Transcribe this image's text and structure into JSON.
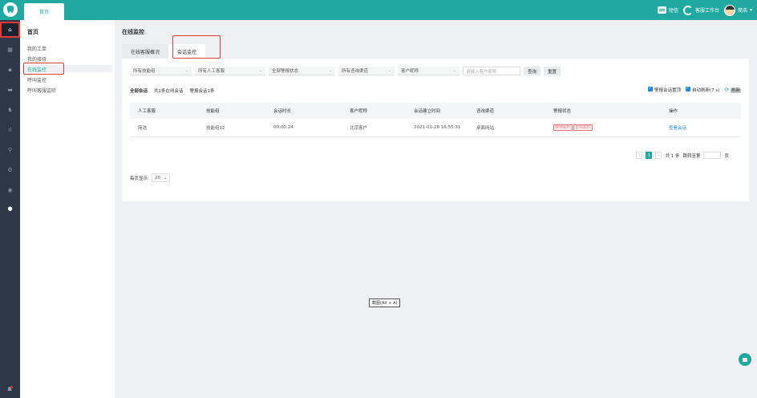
{
  "topbar": {
    "home_tab": "首页",
    "sms_label": "短信",
    "workspace_label": "客服工作台",
    "user_name": "简浩"
  },
  "rail": {
    "items": [
      "home-icon",
      "grid-icon",
      "list-icon",
      "chat-icon",
      "users-icon",
      "chart-icon",
      "search-icon",
      "settings-icon",
      "globe-icon",
      "info-icon"
    ]
  },
  "subnav": {
    "title": "首页",
    "items": [
      "我的工单",
      "我的接待",
      "在线监控",
      "呼叫监控",
      "呼叫客服监听"
    ]
  },
  "main": {
    "title": "在线监控",
    "tabs": [
      "在线客服概况",
      "会话监控"
    ],
    "filters": {
      "skill_group": "所有技能组",
      "agent": "所有人工客服",
      "alarm_status": "全部警报状态",
      "channel": "所有咨询渠道",
      "customer_field": "客户昵称",
      "search_placeholder": "请输入客户昵称",
      "search_btn": "查询",
      "reset_btn": "重置"
    },
    "stats": {
      "all": "全部会话",
      "online": "共1条在线会话",
      "alarm": "警报会话1条"
    },
    "options": {
      "alarm_top": "警报会话置顶",
      "auto_refresh": "自动刷新(7 s)",
      "refresh": "刷新"
    },
    "table": {
      "headers": [
        "人工客服",
        "技能组",
        "会话时长",
        "客户昵称",
        "会话建立时间",
        "咨询渠道",
        "警报状态",
        "操作"
      ],
      "rows": [
        [
          "简浩",
          "技能组12",
          "00:00:24",
          "北京客户",
          "2021-01-28 16:55:31",
          "桌面网站",
          "",
          "查看会话"
        ]
      ],
      "badges": [
        "接待超时",
        "首响超时"
      ]
    },
    "pager": {
      "per_page_label": "每页显示:",
      "per_page": "20",
      "current": "1",
      "total": "共 1 条",
      "jump_label": "跳转至第",
      "page_suffix": "页"
    }
  },
  "tooltip": "截图(Alt + A)",
  "colors": {
    "accent": "#1fa9a0",
    "rail": "#2d3746",
    "highlight": "#e53935"
  }
}
